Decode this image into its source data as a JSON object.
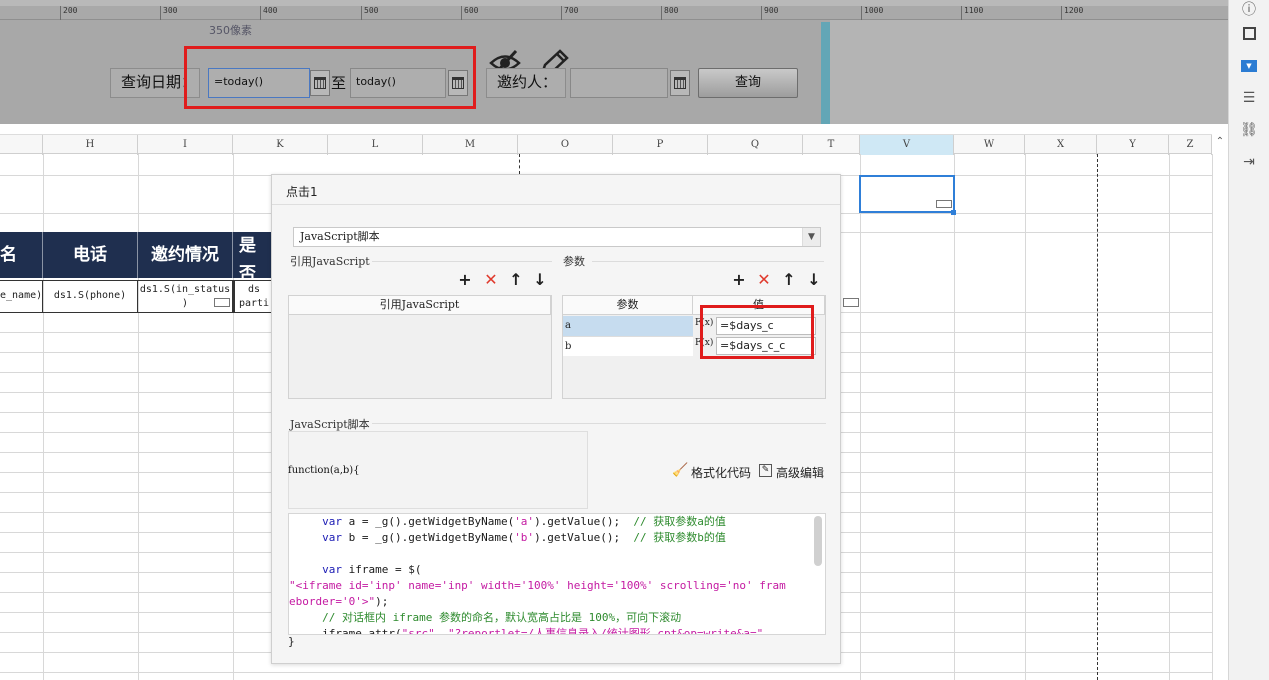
{
  "ruler": {
    "ticks": [
      "200",
      "300",
      "400",
      "500",
      "600",
      "700",
      "800",
      "900",
      "1000",
      "1100",
      "1200"
    ],
    "note": "350像素"
  },
  "param_panel": {
    "date_label": "查询日期：",
    "date_from": "=today()",
    "to_label": "至",
    "date_to": "today()",
    "inviter_label": "邀约人：",
    "inviter_value": "",
    "query_button": "查询"
  },
  "sheet": {
    "columns": [
      "H",
      "I",
      "K",
      "L",
      "M",
      "O",
      "P",
      "Q",
      "T",
      "V",
      "W",
      "X",
      "Y",
      "Z"
    ],
    "selected_column": "V",
    "headers": [
      "名",
      "电话",
      "邀约情况",
      "是否"
    ],
    "data": [
      "e_name)",
      "ds1.S(phone)",
      "ds1.S(in_status",
      ")",
      "ds",
      "parti"
    ]
  },
  "dialog": {
    "title": "点击1",
    "script_type": "JavaScript脚本",
    "ref_js_section": "引用JavaScript",
    "ref_js_column": "引用JavaScript",
    "params_section": "参数",
    "params_columns": [
      "参数",
      "值"
    ],
    "params": [
      {
        "name": "a",
        "value": "=$days_c"
      },
      {
        "name": "b",
        "value": "=$days_c_c"
      }
    ],
    "js_section": "JavaScript脚本",
    "signature": "function(a,b){",
    "format_code": "格式化代码",
    "advanced_edit": "高级编辑",
    "code_lines": {
      "l1_kw": "var",
      "l1_body": " a = _g().getWidgetByName(",
      "l1_str": "'a'",
      "l1_tail": ").getValue();",
      "l1_cmt": "// 获取参数a的值",
      "l2_kw": "var",
      "l2_body": " b = _g().getWidgetByName(",
      "l2_str": "'b'",
      "l2_tail": ").getValue();",
      "l2_cmt": "// 获取参数b的值",
      "l3_kw": "var",
      "l3_body": " iframe = $(",
      "l4_str": "\"<iframe id='inp' name='inp' width='100%' height='100%' scrolling='no' fram",
      "l5_str": "eborder='0'>\"",
      "l5_tail": ");",
      "l6_cmt": "// 对话框内 iframe 参数的命名，默认宽高占比是 100%，可向下滚动",
      "l7_body": "iframe.attr(",
      "l7_str1": "\"src\"",
      "l7_sep": ", ",
      "l7_str2": "\"?reportlet=/人事信息录入/统计图形.cpt&op=write&a=\""
    },
    "closing": "}"
  }
}
